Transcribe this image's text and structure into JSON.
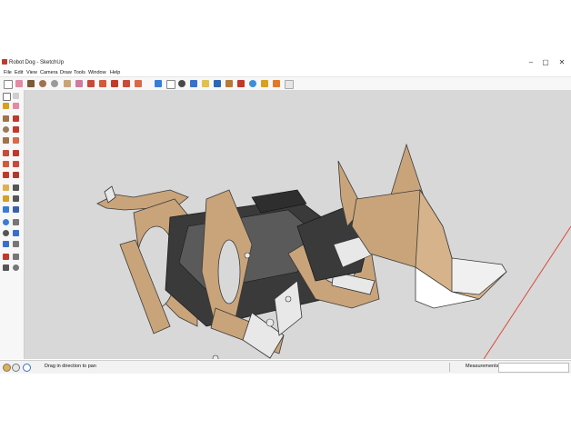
{
  "window": {
    "title": "Robot Dog - SketchUp"
  },
  "menu": [
    "File",
    "Edit",
    "View",
    "Camera",
    "Draw",
    "Tools",
    "Window",
    "Help"
  ],
  "window_controls": {
    "minimize": "–",
    "maximize": "▢",
    "close": "✕"
  },
  "toolbar_icons": [
    "select-icon",
    "eraser-icon",
    "line-icon",
    "rectangle-icon",
    "circle-icon",
    "arc-icon",
    "push-pull-icon",
    "paint-bucket-icon",
    "move-icon",
    "rotate-icon",
    "scale-icon",
    "offset-icon",
    "orbit-icon",
    "pan-icon",
    "zoom-icon",
    "zoom-extents-icon",
    "warehouse-icon",
    "extension-icon",
    "layers-icon",
    "styles-icon",
    "components-icon",
    "share-icon",
    "export-icon"
  ],
  "status": {
    "hint": "Drag in direction to pan",
    "measurements_label": "Measurements",
    "measurements_value": ""
  },
  "colors": {
    "viewport": "#d8d8d8",
    "wood": "#c9a47a",
    "frame": "#2e2e2e",
    "head": "#c8a27a",
    "axis_red": "#d94a3a"
  }
}
